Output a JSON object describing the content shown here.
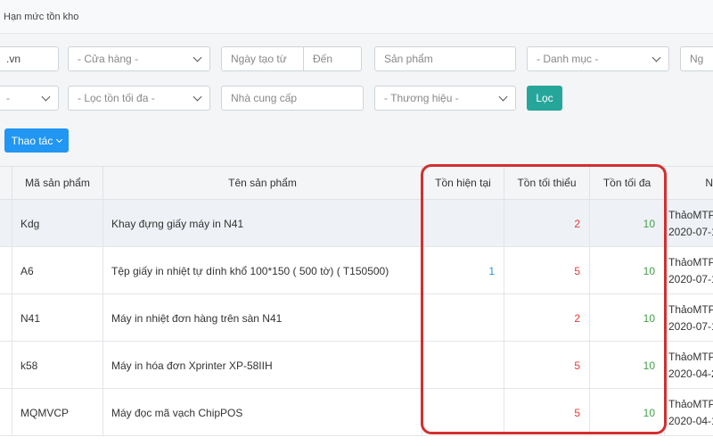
{
  "breadcrumb": "Hạn mức tồn kho",
  "filters": {
    "email_tail": ".vn",
    "store": "- Cửa hàng -",
    "date_from": "Ngày tạo từ",
    "date_to": "Đến",
    "product": "Sản phẩm",
    "category": "- Danh mục -",
    "creator": "Người",
    "min_stock_select": "-",
    "max_stock_select": "- Lọc tồn tối đa -",
    "supplier": "Nhà cung cấp",
    "brand": "- Thương hiệu -",
    "filter_button": "Lọc"
  },
  "actions": {
    "label": "Thao tác"
  },
  "table": {
    "headers": {
      "code": "Mã sản phẩm",
      "name": "Tên sản phẩm",
      "current": "Tồn hiện tại",
      "min": "Tồn tối thiểu",
      "max": "Tồn tối đa",
      "creator": "N"
    },
    "rows": [
      {
        "code": "Kdg",
        "name": "Khay đựng giấy máy in N41",
        "current": "",
        "min": "2",
        "max": "10",
        "creator": "ThảoMTP",
        "date": "2020-07-1"
      },
      {
        "code": "A6",
        "name": "Tệp giấy in nhiệt tự dính khổ 100*150 ( 500 tờ) ( T150500)",
        "current": "1",
        "min": "5",
        "max": "10",
        "creator": "ThảoMTP",
        "date": "2020-07-1"
      },
      {
        "code": "N41",
        "name": "Máy in nhiệt đơn hàng trên sàn N41",
        "current": "",
        "min": "2",
        "max": "10",
        "creator": "ThảoMTP",
        "date": "2020-07-1"
      },
      {
        "code": "k58",
        "name": "Máy in hóa đơn Xprinter XP-58IIH",
        "current": "",
        "min": "5",
        "max": "10",
        "creator": "ThảoMTP",
        "date": "2020-04-2"
      },
      {
        "code": "MQMVCP",
        "name": "Máy đọc mã vạch ChipPOS",
        "current": "",
        "min": "5",
        "max": "10",
        "creator": "ThảoMTP",
        "date": "2020-04-1"
      }
    ]
  },
  "colors": {
    "filter_btn": "#26a69a",
    "action_btn": "#2196f3",
    "highlight": "#d32f2f"
  }
}
